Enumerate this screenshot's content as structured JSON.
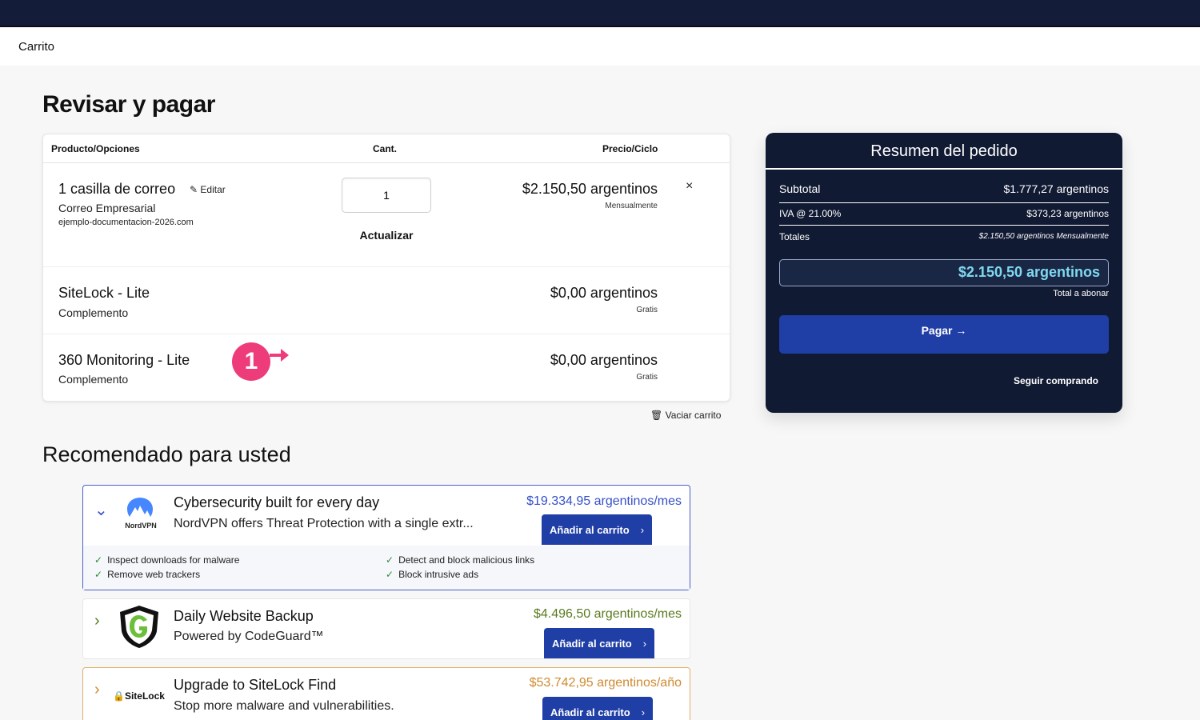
{
  "breadcrumb": "Carrito",
  "page_title": "Revisar y pagar",
  "cart": {
    "headers": {
      "product": "Producto/Opciones",
      "qty": "Cant.",
      "price": "Precio/Ciclo"
    },
    "items": [
      {
        "name": "1 casilla de correo",
        "edit_label": "Editar",
        "sub": "Correo Empresarial",
        "domain": "ejemplo-documentacion-2026.com",
        "qty": "1",
        "update_label": "Actualizar",
        "price": "$2.150,50 argentinos",
        "cycle": "Mensualmente",
        "remove": "×"
      },
      {
        "name": "SiteLock - Lite",
        "sub": "Complemento",
        "price": "$0,00 argentinos",
        "cycle": "Gratis"
      },
      {
        "name": "360 Monitoring - Lite",
        "sub": "Complemento",
        "price": "$0,00 argentinos",
        "cycle": "Gratis",
        "badge": "1"
      }
    ],
    "empty_label": "Vaciar carrito"
  },
  "summary": {
    "title": "Resumen del pedido",
    "subtotal_label": "Subtotal",
    "subtotal_value": "$1.777,27 argentinos",
    "tax_label": "IVA @ 21.00%",
    "tax_value": "$373,23 argentinos",
    "totals_label": "Totales",
    "totals_value": "$2.150,50 argentinos Mensualmente",
    "total": "$2.150,50 argentinos",
    "total_caption": "Total a abonar",
    "pay_label": "Pagar →",
    "continue_label": "Seguir comprando"
  },
  "recommended": {
    "title": "Recomendado para usted",
    "items": [
      {
        "logo": "NordVPN",
        "title": "Cybersecurity built for every day",
        "desc": "NordVPN offers Threat Protection with a single extr...",
        "price": "$19.334,95 argentinos/mes",
        "button": "Añadir al carrito",
        "features": [
          "Inspect downloads for malware",
          "Remove web trackers",
          "Detect and block malicious links",
          "Block intrusive ads"
        ],
        "accent": "#3550c8"
      },
      {
        "title": "Daily Website Backup",
        "desc": "Powered by CodeGuard™",
        "price": "$4.496,50 argentinos/mes",
        "button": "Añadir al carrito",
        "accent": "#5a7a1e"
      },
      {
        "logo": "SiteLock",
        "logo_a": "SiteLock",
        "title": "Upgrade to SiteLock Find",
        "desc": "Stop more malware and vulnerabilities.",
        "price": "$53.742,95 argentinos/año",
        "button": "Añadir al carrito",
        "accent": "#d08a30"
      }
    ]
  },
  "colors": {
    "navy": "#111a33",
    "button_blue": "#1f3ea6",
    "badge_pink": "#ee3b79"
  }
}
